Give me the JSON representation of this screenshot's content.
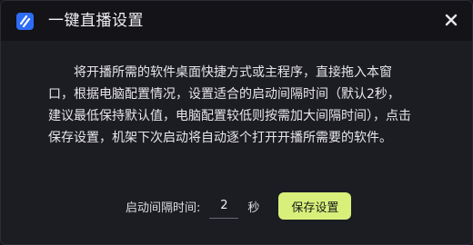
{
  "window": {
    "title": "一键直播设置",
    "logo_icon": "app-logo-icon",
    "close_icon": "close-icon",
    "accent_color": "#2f6cf6"
  },
  "description": "将开播所需的软件桌面快捷方式或主程序，直接拖入本窗口，根据电脑配置情况，设置适合的启动间隔时间（默认2秒，建议最低保持默认值，电脑配置较低则按需加大间隔时间），点击保存设置，机架下次启动将自动逐个打开开播所需要的软件。",
  "settings": {
    "interval_label": "启动间隔时间:",
    "interval_value": "2",
    "unit_label": "秒",
    "save_label": "保存设置",
    "save_color": "#d8f07a"
  }
}
